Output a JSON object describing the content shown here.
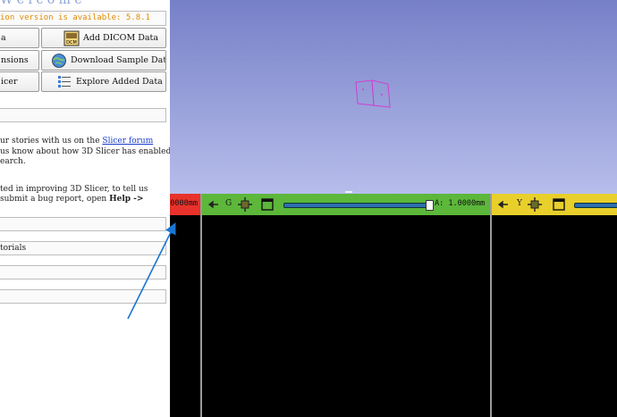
{
  "welcome": {
    "title_partial": "W e l c o m e",
    "update_notice": "ion version is available: 5.8.1",
    "buttons": [
      {
        "label": "a",
        "icon": "data-icon"
      },
      {
        "label": "Add DICOM Data",
        "icon": "dicom-icon"
      },
      {
        "label": "nsions",
        "icon": "extensions-icon"
      },
      {
        "label": "Download Sample Data",
        "icon": "globe-download-icon"
      },
      {
        "label": "icer",
        "icon": "slicer-icon"
      },
      {
        "label": "Explore Added Data",
        "icon": "explore-data-icon"
      }
    ],
    "feedback": {
      "line1_pre": "ur stories with us on the ",
      "line1_link": "Slicer forum",
      "line2": "us know about how 3D Slicer has enabled",
      "line3": "earch.",
      "line4": "ted in improving 3D Slicer, to tell us",
      "line5_pre": " submit a bug report, open ",
      "line5_bold": "Help ->"
    },
    "sections": [
      {
        "label": ""
      },
      {
        "label": "torials"
      },
      {
        "label": ""
      },
      {
        "label": ""
      }
    ]
  },
  "slice_views": {
    "red": {
      "readout": "0000mm",
      "color": "#e8322b"
    },
    "green": {
      "letter": "G",
      "readout": "A: 1.0000mm",
      "slider_fraction": 1.0,
      "color": "#5cb73a"
    },
    "yellow": {
      "letter": "Y",
      "color": "#e8cf2b"
    }
  },
  "colors": {
    "accent": "#1976d2",
    "update_text": "#e08a00"
  }
}
